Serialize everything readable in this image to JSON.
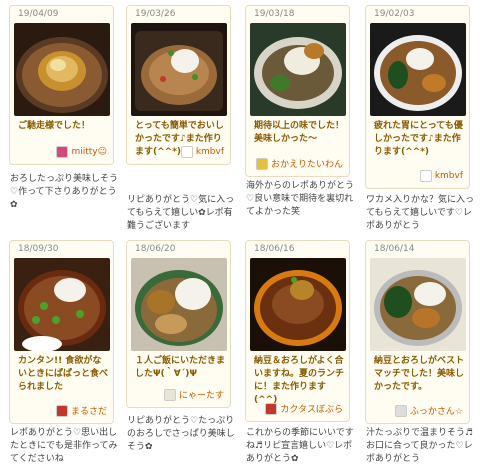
{
  "cards": [
    {
      "date": "19/04/09",
      "comment": "ご馳走様でした！",
      "author": "miitty☺",
      "reply": "おろしたっぷり美味しそう♡作って下さりありがとう✿",
      "author_icon_color": "#d04a7a"
    },
    {
      "date": "19/03/26",
      "comment": "とっても簡単でおいしかったです♪また作ります(^^*)",
      "author": "kmbvf",
      "reply": "リピありがとう♡気に入ってもらえて嬉しい✿レポ有難うございます",
      "author_icon_color": "#ffffff"
    },
    {
      "date": "19/03/18",
      "comment": "期待以上の味でした！美味しかった〜",
      "author": "おかえりたいわん",
      "reply": "海外からのレポありがとう♡良い意味で期待を裏切れてよかった笑",
      "author_icon_color": "#e2c23a"
    },
    {
      "date": "19/02/03",
      "comment": "疲れた胃にとっても優しかったです♪また作ります(^^*)",
      "author": "kmbvf",
      "reply": "ワカメ入りかな？気に入ってもらえて嬉しいです♡レポありがとう",
      "author_icon_color": "#ffffff"
    },
    {
      "date": "18/09/30",
      "comment": "カンタン!! 食欲がないときにぱぱっと食べられました",
      "author": "まるさだ",
      "reply": "レポありがとう♡思い出したときにでも是非作ってみてくださいね",
      "author_icon_color": "#c0392b"
    },
    {
      "date": "18/06/20",
      "comment": "１人ご飯にいただきましたΨ(｀∀´)Ψ",
      "author": "にゃーたす",
      "reply": "リピありがとう♡たっぷりのおろしでさっぱり美味しそう✿",
      "author_icon_color": "#e8e4d8"
    },
    {
      "date": "18/06/16",
      "comment": "納豆＆おろしがよく合いますね。夏のランチに！また作ります(^^)",
      "author": "カクタスぼぶら",
      "reply": "これからの季節にいいですね♬リピ宣言嬉しい♡レポありがとう✿",
      "author_icon_color": "#c0392b"
    },
    {
      "date": "18/06/14",
      "comment": "納豆とおろしがベストマッチでした！美味しかったです。",
      "author": "ふっかさん☆",
      "reply": "汁たっぷりで温まりそう♬お口に合って良かった♡レポありがとう",
      "author_icon_color": "#dddddd"
    }
  ]
}
